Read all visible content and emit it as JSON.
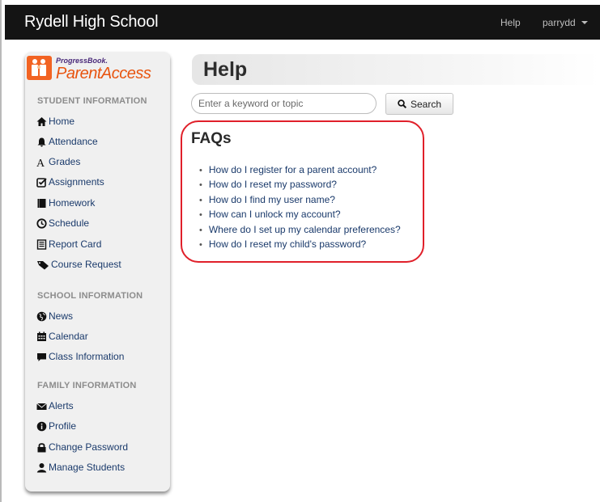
{
  "header": {
    "title": "Rydell High School",
    "help_label": "Help",
    "user_label": "parrydd"
  },
  "logo": {
    "small": "ProgressBook.",
    "big": "ParentAccess"
  },
  "sidebar": {
    "sections": [
      {
        "title": "STUDENT INFORMATION",
        "items": [
          {
            "label": "Home",
            "icon": "home-icon"
          },
          {
            "label": "Attendance",
            "icon": "bell-icon"
          },
          {
            "label": "Grades",
            "icon": "font-icon"
          },
          {
            "label": "Assignments",
            "icon": "checkbox-edit-icon"
          },
          {
            "label": "Homework",
            "icon": "book-icon"
          },
          {
            "label": "Schedule",
            "icon": "clock-icon"
          },
          {
            "label": "Report Card",
            "icon": "report-icon"
          },
          {
            "label": "Course Request",
            "icon": "tag-icon"
          }
        ]
      },
      {
        "title": "SCHOOL INFORMATION",
        "items": [
          {
            "label": "News",
            "icon": "globe-icon"
          },
          {
            "label": "Calendar",
            "icon": "calendar-icon"
          },
          {
            "label": "Class Information",
            "icon": "comment-icon"
          }
        ]
      },
      {
        "title": "FAMILY INFORMATION",
        "items": [
          {
            "label": "Alerts",
            "icon": "envelope-icon"
          },
          {
            "label": "Profile",
            "icon": "info-icon"
          },
          {
            "label": "Change Password",
            "icon": "lock-icon"
          },
          {
            "label": "Manage Students",
            "icon": "user-icon"
          }
        ]
      }
    ]
  },
  "main": {
    "page_title": "Help",
    "search": {
      "placeholder": "Enter a keyword or topic",
      "value": "",
      "button_label": "Search"
    },
    "faq": {
      "title": "FAQs",
      "items": [
        "How do I register for a parent account?",
        "How do I reset my password?",
        "How do I find my user name?",
        "How can I unlock my account?",
        "Where do I set up my calendar preferences?",
        "How do I reset my child's password?"
      ]
    }
  },
  "colors": {
    "topbar": "#141414",
    "link": "#1a3a6b",
    "highlight": "#e0202a",
    "brand_orange": "#f26322"
  }
}
